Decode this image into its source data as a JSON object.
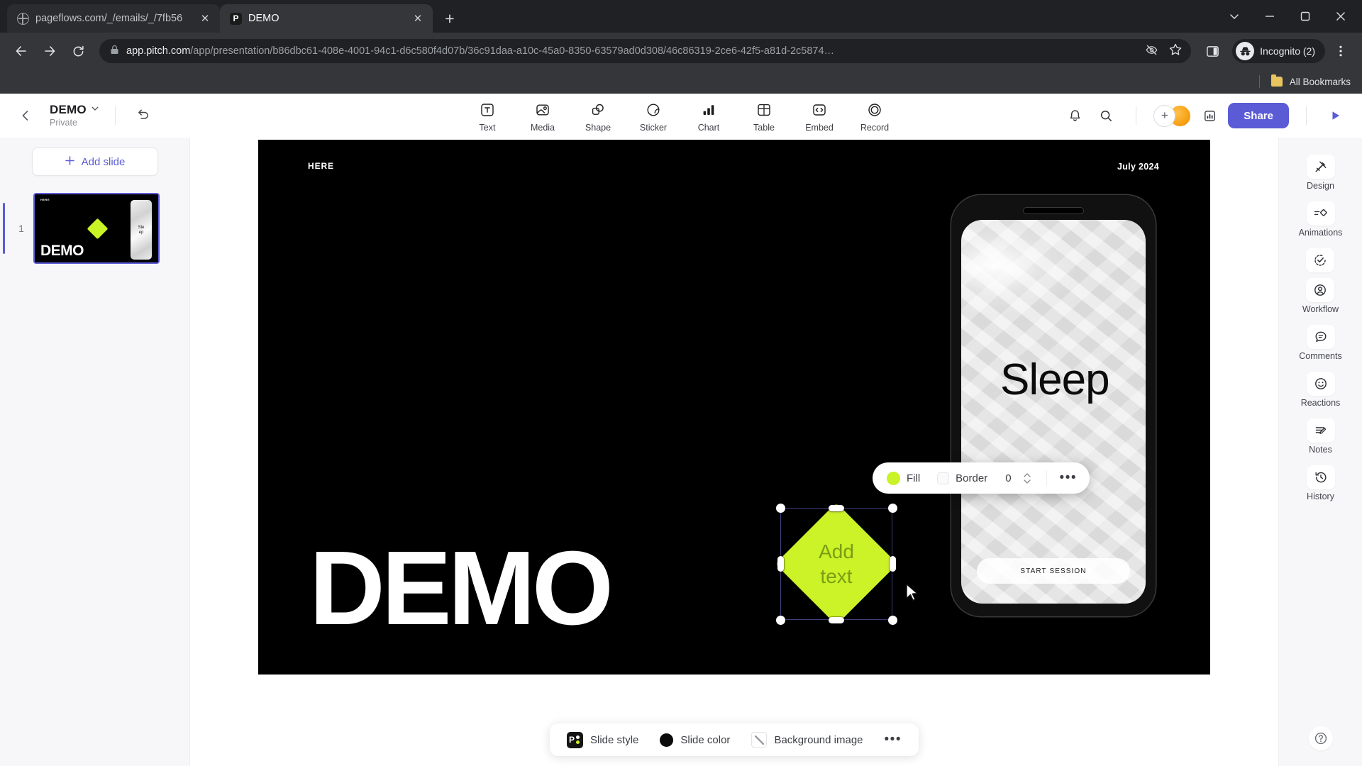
{
  "browser": {
    "tabs": [
      {
        "title": "pageflows.com/_/emails/_/7fb56",
        "favicon": "globe-icon",
        "active": false
      },
      {
        "title": "DEMO",
        "favicon": "pitch-icon",
        "active": true
      }
    ],
    "new_tab_label": "+",
    "url_host": "app.pitch.com",
    "url_path": "/app/presentation/b86dbc61-408e-4001-94c1-d6c580f4d07b/36c91daa-a10c-45a0-8350-63579ad0d308/46c86319-2ce6-42f5-a81d-2c5874…",
    "profile_label": "Incognito (2)",
    "bookmarks_label": "All Bookmarks"
  },
  "header": {
    "deck_title": "DEMO",
    "deck_privacy": "Private",
    "tools": [
      {
        "label": "Text",
        "icon": "text-icon"
      },
      {
        "label": "Media",
        "icon": "media-icon"
      },
      {
        "label": "Shape",
        "icon": "shape-icon"
      },
      {
        "label": "Sticker",
        "icon": "sticker-icon"
      },
      {
        "label": "Chart",
        "icon": "chart-icon"
      },
      {
        "label": "Table",
        "icon": "table-icon"
      },
      {
        "label": "Embed",
        "icon": "embed-icon"
      },
      {
        "label": "Record",
        "icon": "record-icon"
      }
    ],
    "share_label": "Share"
  },
  "slides_panel": {
    "add_slide_label": "Add slide",
    "slides": [
      {
        "number": "1",
        "selected": true
      }
    ]
  },
  "format_bar": {
    "fill_label": "Fill",
    "fill_color": "#c9f227",
    "border_label": "Border",
    "border_value": "0",
    "more_label": "•••"
  },
  "canvas": {
    "eyebrow": "HERE",
    "date": "July 2024",
    "headline": "DEMO",
    "shape": {
      "type": "diamond",
      "placeholder": "Add text",
      "fill": "#ccf228",
      "selected": true
    },
    "phone": {
      "title": "Sleep",
      "cta_label": "START SESSION"
    }
  },
  "slide_bar": {
    "style_label": "Slide style",
    "color_label": "Slide color",
    "color_value": "#0b0b0b",
    "background_label": "Background image",
    "more_label": "•••"
  },
  "rail": {
    "items": [
      {
        "label": "Design",
        "icon": "design-icon"
      },
      {
        "label": "Animations",
        "icon": "animations-icon"
      },
      {
        "label": "Workflow",
        "icon": "workflow-icon"
      },
      {
        "label": "Comments",
        "icon": "comments-icon"
      },
      {
        "label": "Reactions",
        "icon": "reactions-icon"
      },
      {
        "label": "Notes",
        "icon": "notes-icon"
      },
      {
        "label": "History",
        "icon": "history-icon"
      }
    ]
  }
}
